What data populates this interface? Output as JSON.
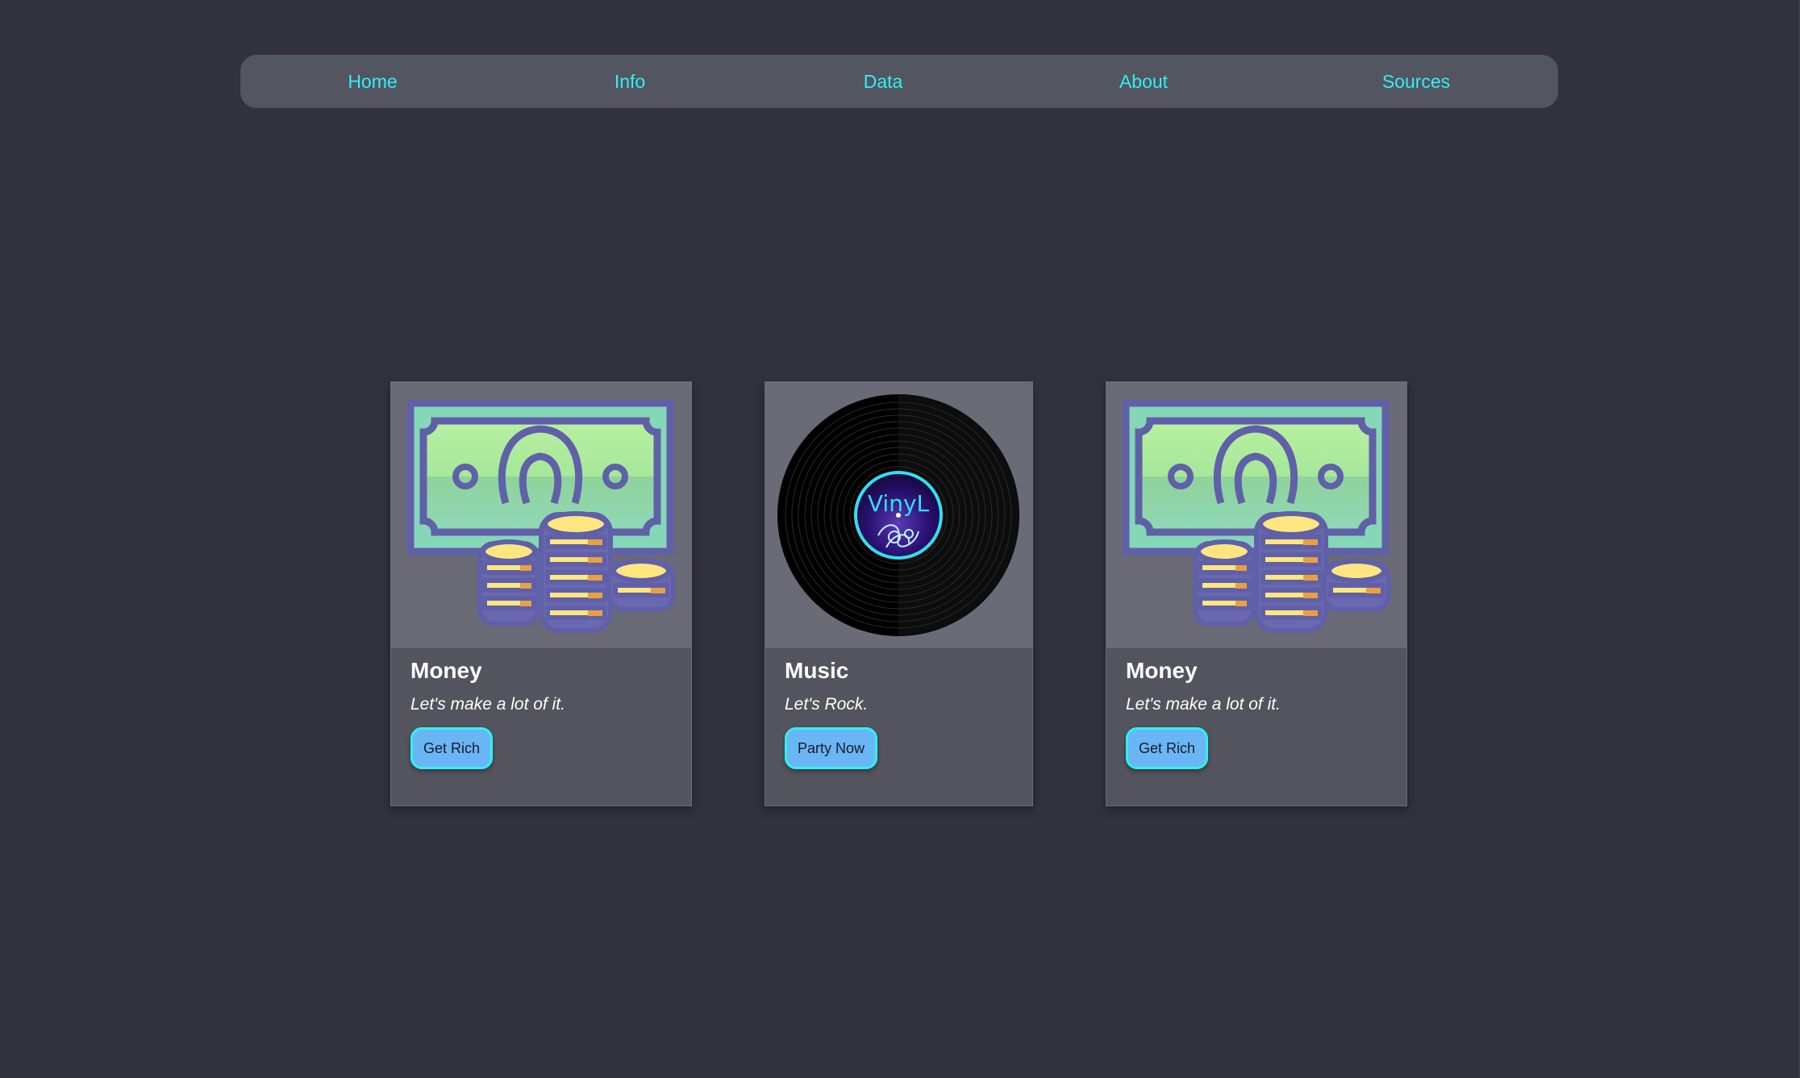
{
  "nav": {
    "items": [
      {
        "label": "Home"
      },
      {
        "label": "Info"
      },
      {
        "label": "Data"
      },
      {
        "label": "About"
      },
      {
        "label": "Sources"
      }
    ]
  },
  "cards": [
    {
      "title": "Money",
      "subtitle": "Let's make a lot of it.",
      "button": "Get Rich",
      "image": "money-icon"
    },
    {
      "title": "Music",
      "subtitle": "Let's Rock.",
      "button": "Party Now",
      "image": "vinyl-record-icon",
      "image_label": "VinyL"
    },
    {
      "title": "Money",
      "subtitle": "Let's make a lot of it.",
      "button": "Get Rich",
      "image": "money-icon"
    }
  ],
  "colors": {
    "background": "#32323e",
    "nav_background": "#535561",
    "nav_link": "#2ff0f4",
    "card_background": "#53545e",
    "button_background": "#6ab6f4",
    "button_border": "#2ff0f4"
  }
}
